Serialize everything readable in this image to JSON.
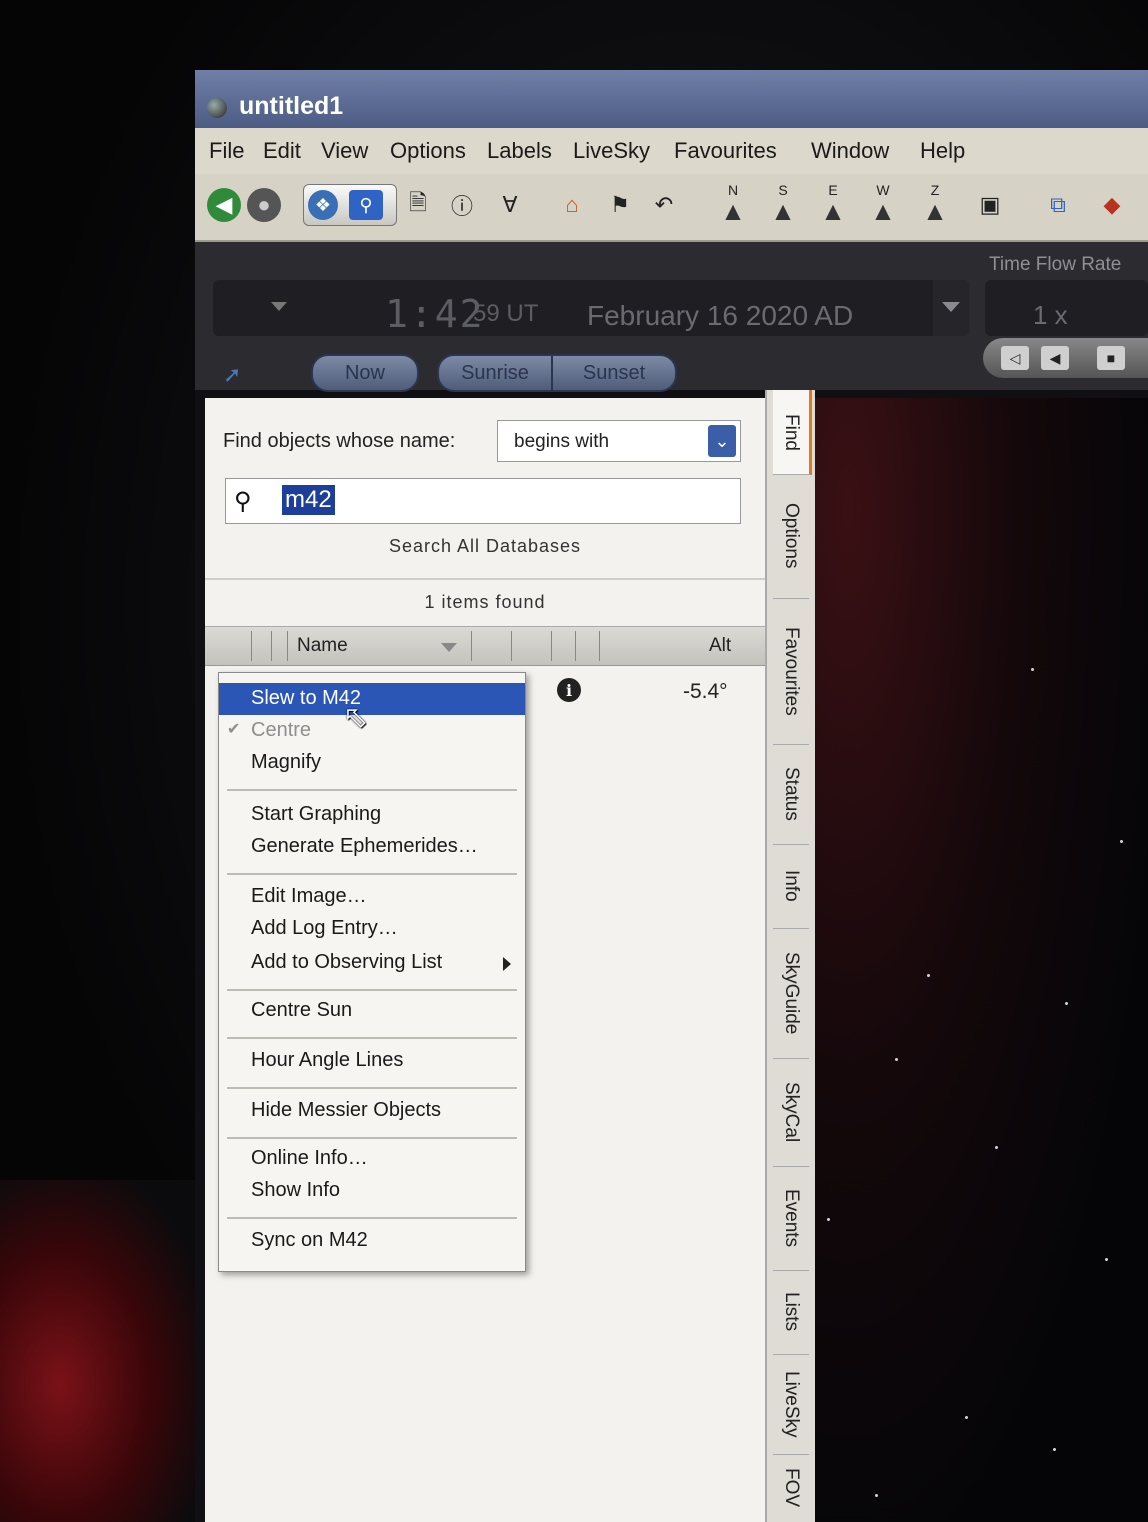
{
  "window": {
    "title": "untitled1"
  },
  "menu": [
    "File",
    "Edit",
    "View",
    "Options",
    "Labels",
    "LiveSky",
    "Favourites",
    "Window",
    "Help"
  ],
  "toolbar": {
    "nsew": [
      "N",
      "S",
      "E",
      "W",
      "Z"
    ]
  },
  "time": {
    "flow_label": "Time Flow Rate",
    "hm": "1:42",
    "sec": "59 UT",
    "date": "February 16   2020 AD",
    "rate": "1 x",
    "now": "Now",
    "sunrise": "Sunrise",
    "sunset": "Sunset"
  },
  "find": {
    "label": "Find objects whose name:",
    "match_mode": "begins with",
    "query": "m42",
    "search_all": "Search All Databases",
    "items_found": "1 items found",
    "col_name": "Name",
    "col_alt": "Alt",
    "result_alt": "-5.4°"
  },
  "tabs": [
    "Find",
    "Options",
    "Favourites",
    "Status",
    "Info",
    "SkyGuide",
    "SkyCal",
    "Events",
    "Lists",
    "LiveSky",
    "FOV"
  ],
  "context_menu": {
    "slew": "Slew to M42",
    "centre": "Centre",
    "magnify": "Magnify",
    "start_graphing": "Start Graphing",
    "ephemerides": "Generate Ephemerides…",
    "edit_image": "Edit Image…",
    "add_log": "Add Log Entry…",
    "add_list": "Add to Observing List",
    "centre_sun": "Centre Sun",
    "hour_angle": "Hour Angle Lines",
    "hide_messier": "Hide Messier Objects",
    "online_info": "Online Info…",
    "show_info": "Show Info",
    "sync": "Sync on M42"
  },
  "colors": {
    "highlight": "#2b56b6",
    "active_tab": "#e07a1f",
    "titlebar": "#5a6a92"
  }
}
